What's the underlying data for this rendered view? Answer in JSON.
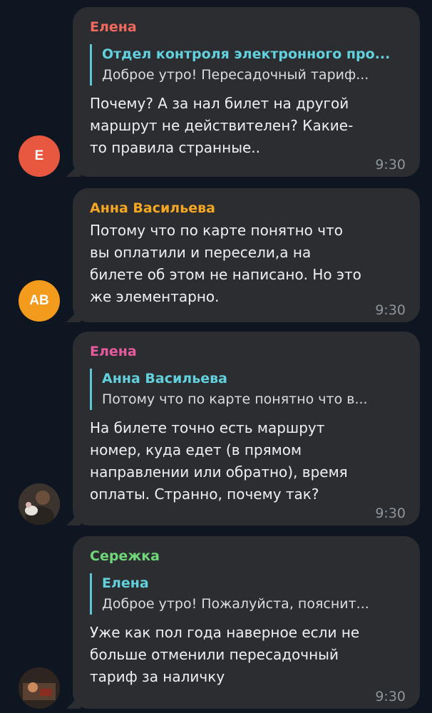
{
  "messages": [
    {
      "sender": "Елена",
      "sender_color": "#f06a5d",
      "reply_author": "Отдел контроля электронного про...",
      "reply_text": "Доброе утро! Пересадочный тариф...",
      "text": "Почему? А за нал билет на другой маршрут не действителен? Какие-то правила странные..",
      "time": "9:30",
      "avatar_initials": "Е",
      "avatar_color": "#e8573f"
    },
    {
      "sender": "Анна Васильева",
      "sender_color": "#f5a623",
      "text": "Потому что по карте понятно что вы оплатили и пересели,а на билете об этом не написано. Но это же элементарно.",
      "time": "9:30",
      "avatar_initials": "АВ",
      "avatar_color": "#f29b1d"
    },
    {
      "sender": "Елена",
      "sender_color": "#e65b9d",
      "reply_author": "Анна Васильева",
      "reply_text": "Потому что по карте понятно что в...",
      "text": "На билете точно есть маршрут номер, куда едет (в прямом направлении или обратно), время оплаты. Странно, почему так?",
      "time": "9:30",
      "avatar_icon": "user-photo"
    },
    {
      "sender": "Сережка",
      "sender_color": "#6fd67a",
      "reply_author": "Елена",
      "reply_text": "Доброе утро! Пожалуйста, пояснит...",
      "text": "Уже как пол года наверное если не больше отменили пересадочный тариф за наличку",
      "time": "9:30",
      "avatar_icon": "user-photo"
    }
  ]
}
